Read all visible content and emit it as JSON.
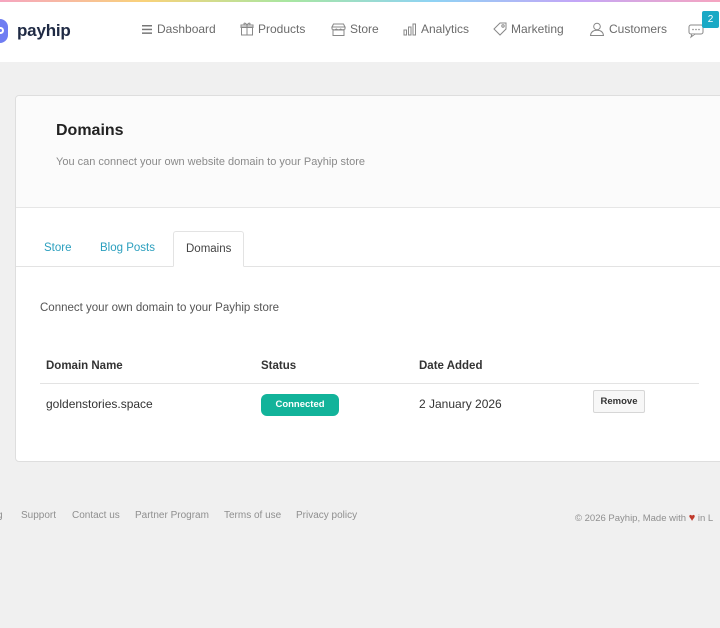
{
  "brand": {
    "name": "payhip",
    "accent": "#6f7df2"
  },
  "nav": {
    "items": [
      {
        "label": "Dashboard",
        "icon": "menu-lines-icon"
      },
      {
        "label": "Products",
        "icon": "gift-icon"
      },
      {
        "label": "Store",
        "icon": "storefront-icon"
      },
      {
        "label": "Analytics",
        "icon": "bar-chart-icon"
      },
      {
        "label": "Marketing",
        "icon": "tag-icon"
      },
      {
        "label": "Customers",
        "icon": "user-icon"
      }
    ],
    "chat": {
      "icon": "chat-bubbles-icon",
      "badge": "2"
    }
  },
  "page": {
    "title": "Domains",
    "subtitle": "You can connect your own website domain to your Payhip store"
  },
  "tabs": [
    {
      "label": "Store",
      "active": false
    },
    {
      "label": "Blog Posts",
      "active": false
    },
    {
      "label": "Domains",
      "active": true
    }
  ],
  "content": {
    "intro": "Connect your own domain to your Payhip store",
    "table": {
      "headers": [
        "Domain Name",
        "Status",
        "Date Added"
      ],
      "rows": [
        {
          "domain": "goldenstories.space",
          "status": "Connected",
          "date_added": "2 January 2026",
          "action": "Remove"
        }
      ]
    }
  },
  "colors": {
    "status_connected": "#12b39a",
    "link": "#2b9fbe",
    "badge": "#1aa9c5"
  },
  "footer": {
    "links": [
      "g",
      "Support",
      "Contact us",
      "Partner Program",
      "Terms of use",
      "Privacy policy"
    ],
    "copyright_prefix": "© 2026 Payhip, Made with",
    "heart": "♥",
    "copyright_suffix": "in L"
  }
}
